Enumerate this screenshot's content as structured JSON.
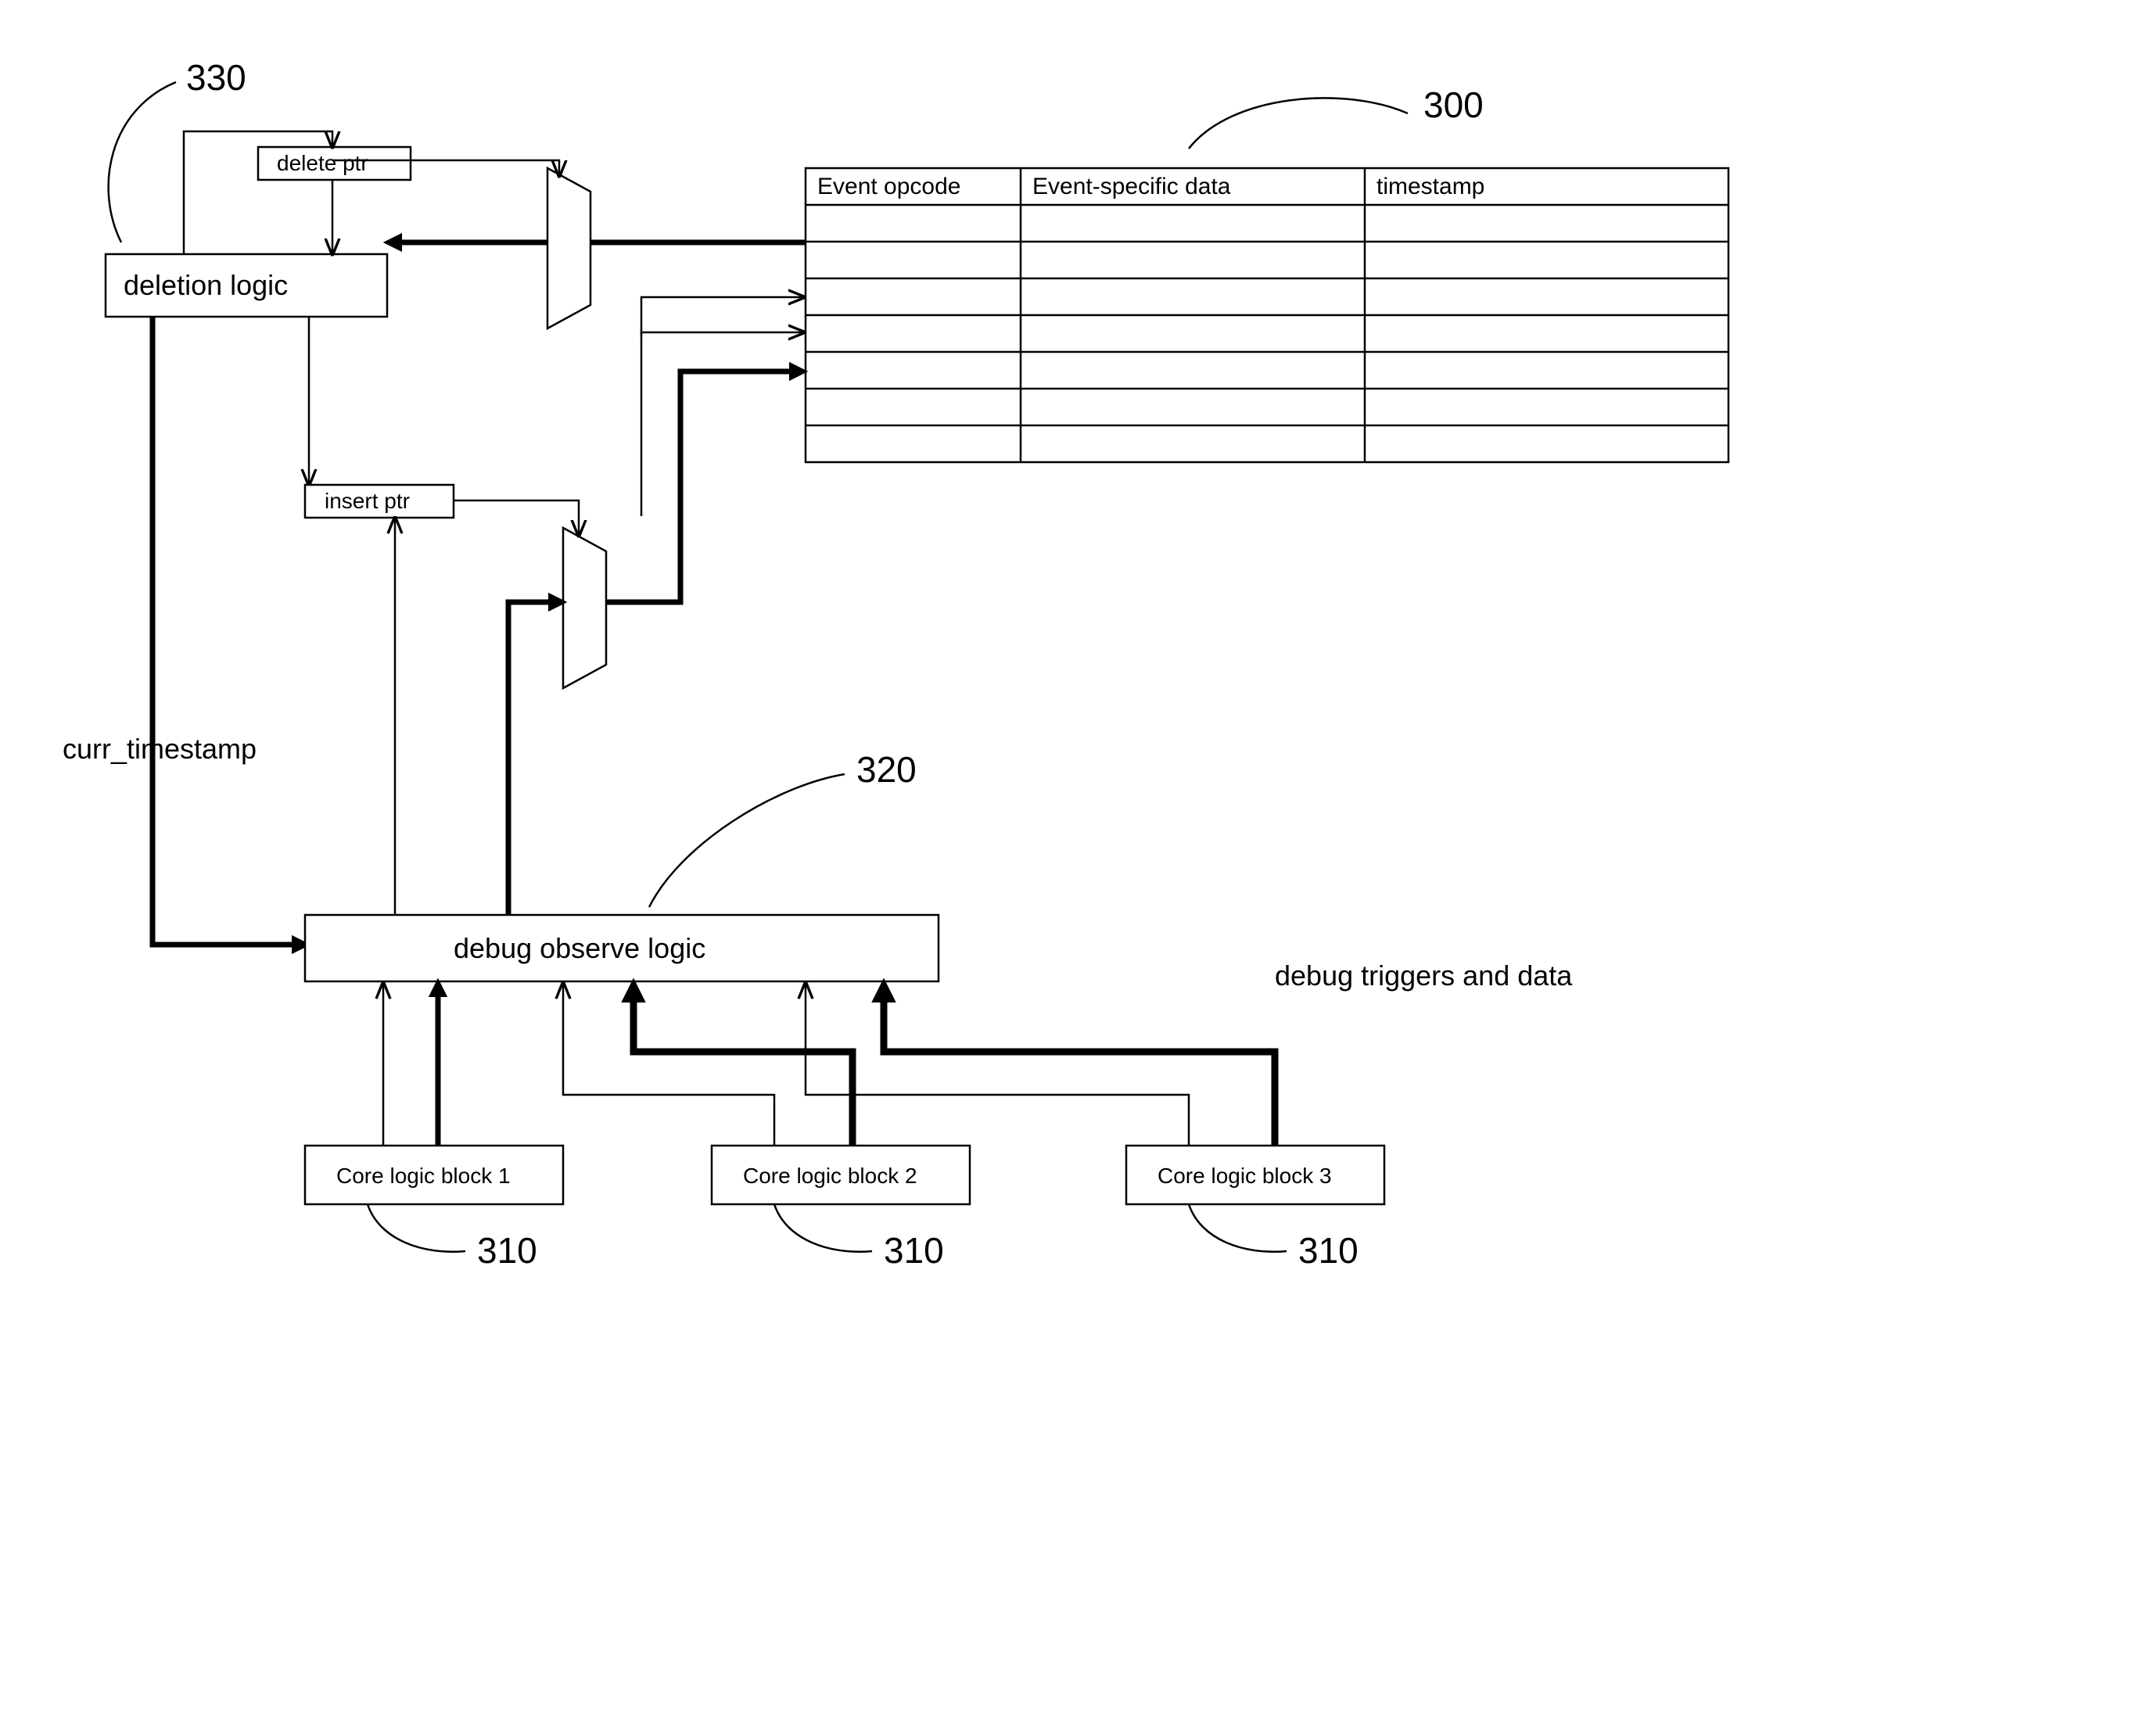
{
  "refs": {
    "table": "300",
    "core": "310",
    "debug": "320",
    "deletion": "330"
  },
  "labels": {
    "delete_ptr": "delete ptr",
    "deletion_logic": "deletion logic",
    "insert_ptr": "insert ptr",
    "curr_timestamp": "curr_timestamp",
    "debug_observe": "debug observe logic",
    "core1": "Core logic block 1",
    "core2": "Core logic block 2",
    "core3": "Core logic block 3",
    "debug_triggers": "debug triggers and data"
  },
  "table_headers": {
    "c1": "Event opcode",
    "c2": "Event-specific data",
    "c3": "timestamp"
  }
}
